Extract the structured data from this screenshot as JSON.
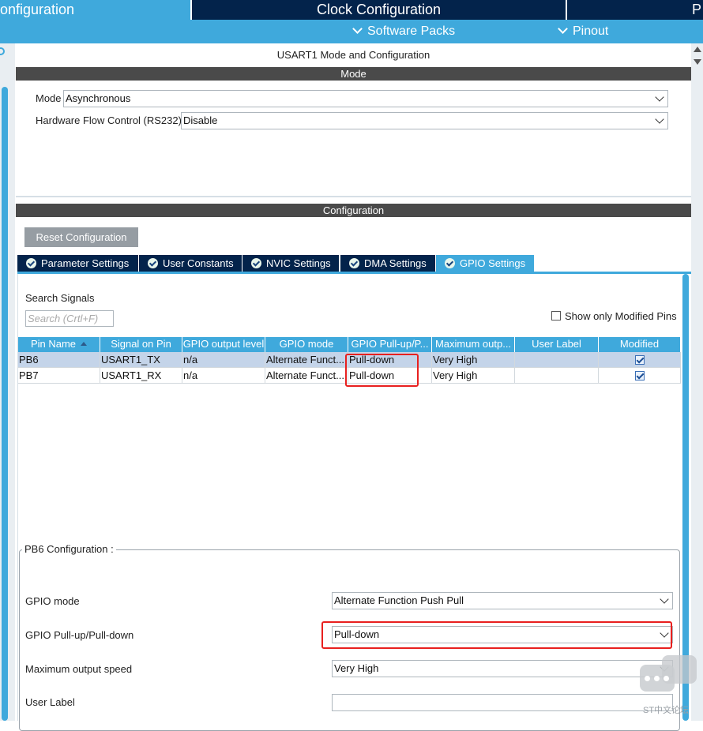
{
  "top_tabs": [
    {
      "label": "onfiguration"
    },
    {
      "label": "Clock Configuration"
    },
    {
      "label": "P"
    }
  ],
  "sub_menu": [
    {
      "label": "Software Packs"
    },
    {
      "label": "Pinout"
    }
  ],
  "panel_title": "USART1 Mode and Configuration",
  "mode_section": {
    "title": "Mode",
    "mode_label": "Mode",
    "mode_value": "Asynchronous",
    "flow_label": "Hardware Flow Control (RS232)",
    "flow_value": "Disable"
  },
  "config_section": {
    "title": "Configuration",
    "reset_label": "Reset Configuration",
    "tabs": [
      {
        "label": "Parameter Settings"
      },
      {
        "label": "User Constants"
      },
      {
        "label": "NVIC Settings"
      },
      {
        "label": "DMA Settings"
      },
      {
        "label": "GPIO Settings"
      }
    ]
  },
  "gpio": {
    "search_label": "Search Signals",
    "search_placeholder": "Search (Crtl+F)",
    "show_modified_label": "Show only Modified Pins",
    "columns": [
      "Pin Name",
      "Signal on Pin",
      "GPIO output level",
      "GPIO mode",
      "GPIO Pull-up/P...",
      "Maximum outp...",
      "User Label",
      "Modified"
    ],
    "rows": [
      {
        "pin": "PB6",
        "signal": "USART1_TX",
        "level": "n/a",
        "mode": "Alternate Funct...",
        "pull": "Pull-down",
        "speed": "Very High",
        "label": "",
        "modified": true
      },
      {
        "pin": "PB7",
        "signal": "USART1_RX",
        "level": "n/a",
        "mode": "Alternate Funct...",
        "pull": "Pull-down",
        "speed": "Very High",
        "label": "",
        "modified": true
      }
    ]
  },
  "pb6_config": {
    "legend": "PB6 Configuration :",
    "gpio_mode_label": "GPIO mode",
    "gpio_mode_value": "Alternate Function Push Pull",
    "pull_label": "GPIO Pull-up/Pull-down",
    "pull_value": "Pull-down",
    "speed_label": "Maximum output speed",
    "speed_value": "Very High",
    "user_label_label": "User Label",
    "user_label_value": ""
  },
  "watermark": "ST中文论坛",
  "colors": {
    "navy": "#03234b",
    "accent": "#3fa9dc",
    "section_bar": "#4a4a4a",
    "highlight_red": "#e8201f"
  }
}
